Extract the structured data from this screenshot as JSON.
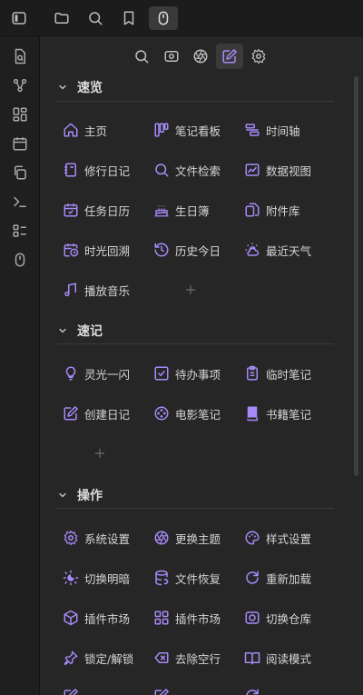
{
  "sections": {
    "overview": {
      "title": "速览",
      "items": [
        {
          "label": "主页",
          "icon": "home-icon"
        },
        {
          "label": "笔记看板",
          "icon": "kanban-icon"
        },
        {
          "label": "时间轴",
          "icon": "timeline-icon"
        },
        {
          "label": "修行日记",
          "icon": "diary-icon"
        },
        {
          "label": "文件检索",
          "icon": "search-icon"
        },
        {
          "label": "数据视图",
          "icon": "chart-icon"
        },
        {
          "label": "任务日历",
          "icon": "calendar-check-icon"
        },
        {
          "label": "生日簿",
          "icon": "cake-icon"
        },
        {
          "label": "附件库",
          "icon": "attachment-icon"
        },
        {
          "label": "时光回溯",
          "icon": "calendar-clock-icon"
        },
        {
          "label": "历史今日",
          "icon": "history-icon"
        },
        {
          "label": "最近天气",
          "icon": "weather-icon"
        },
        {
          "label": "播放音乐",
          "icon": "music-icon"
        }
      ]
    },
    "quick_notes": {
      "title": "速记",
      "items": [
        {
          "label": "灵光一闪",
          "icon": "lightbulb-icon"
        },
        {
          "label": "待办事项",
          "icon": "checkbox-icon"
        },
        {
          "label": "临时笔记",
          "icon": "clipboard-icon"
        },
        {
          "label": "创建日记",
          "icon": "edit-icon"
        },
        {
          "label": "电影笔记",
          "icon": "film-reel-icon"
        },
        {
          "label": "书籍笔记",
          "icon": "book-icon"
        }
      ]
    },
    "actions": {
      "title": "操作",
      "items": [
        {
          "label": "系统设置",
          "icon": "gear-icon"
        },
        {
          "label": "更换主题",
          "icon": "aperture-icon"
        },
        {
          "label": "样式设置",
          "icon": "palette-icon"
        },
        {
          "label": "切换明暗",
          "icon": "sun-moon-icon"
        },
        {
          "label": "文件恢复",
          "icon": "database-restore-icon"
        },
        {
          "label": "重新加载",
          "icon": "reload-icon"
        },
        {
          "label": "插件市场",
          "icon": "cube-icon"
        },
        {
          "label": "插件市场",
          "icon": "grid-plus-icon"
        },
        {
          "label": "切换仓库",
          "icon": "vault-switch-icon"
        },
        {
          "label": "锁定/解锁",
          "icon": "pin-icon"
        },
        {
          "label": "去除空行",
          "icon": "backspace-icon"
        },
        {
          "label": "阅读模式",
          "icon": "book-open-icon"
        }
      ]
    }
  },
  "colors": {
    "accent": "#a68af9",
    "icon_muted": "#a0a0a0",
    "background": "#262626"
  }
}
